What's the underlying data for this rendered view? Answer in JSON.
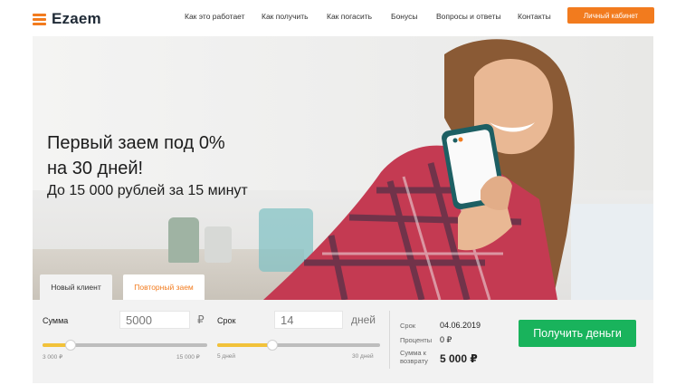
{
  "header": {
    "logo_text": "Ezaem",
    "nav": [
      {
        "label": "Как это работает"
      },
      {
        "label": "Как получить"
      },
      {
        "label": "Как погасить"
      },
      {
        "label": "Бонусы"
      },
      {
        "label": "Вопросы и ответы"
      },
      {
        "label": "Контакты"
      }
    ],
    "cabinet_label": "Личный кабинет"
  },
  "hero": {
    "headline_line1": "Первый заем под 0%",
    "headline_line2": "на 30 дней!",
    "subline": "До 15 000 рублей за 15 минут"
  },
  "tabs": {
    "new_client": "Новый клиент",
    "repeat_loan": "Повторный заем",
    "active": "repeat_loan"
  },
  "calculator": {
    "amount": {
      "label": "Сумма",
      "value": "5000",
      "unit": "₽",
      "min_label": "3 000 ₽",
      "max_label": "15 000 ₽",
      "slider_fraction": 0.17
    },
    "term": {
      "label": "Срок",
      "value": "14",
      "unit": "дней",
      "min_label": "5 дней",
      "max_label": "30 дней",
      "slider_fraction": 0.34
    },
    "summary": {
      "date_label": "Срок",
      "date_value": "04.06.2019",
      "percent_label": "Проценты",
      "percent_value": "0 ₽",
      "return_label_1": "Сумма к",
      "return_label_2": "возврату",
      "return_value": "5 000 ₽"
    },
    "submit_label": "Получить деньги"
  },
  "colors": {
    "accent": "#f27b1e",
    "button_green": "#19b35c",
    "slider_fill": "#f2c23a"
  }
}
